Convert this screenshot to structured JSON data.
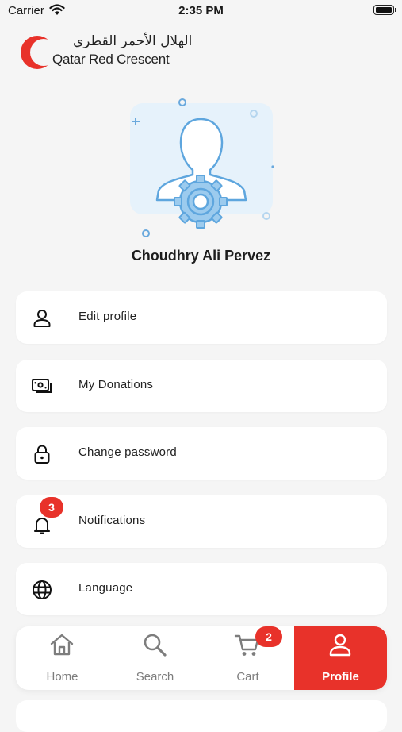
{
  "status_bar": {
    "carrier": "Carrier",
    "time": "2:35 PM"
  },
  "logo": {
    "arabic": "الهلال الأحمر القطري",
    "english": "Qatar Red Crescent"
  },
  "profile": {
    "name": "Choudhry Ali Pervez"
  },
  "menu": [
    {
      "label": "Edit profile",
      "icon": "user-icon"
    },
    {
      "label": "My Donations",
      "icon": "donations-icon"
    },
    {
      "label": "Change password",
      "icon": "lock-icon"
    },
    {
      "label": "Notifications",
      "icon": "bell-icon",
      "badge": "3"
    },
    {
      "label": "Language",
      "icon": "globe-icon"
    }
  ],
  "tabs": [
    {
      "label": "Home",
      "icon": "home-icon"
    },
    {
      "label": "Search",
      "icon": "search-icon"
    },
    {
      "label": "Cart",
      "icon": "cart-icon",
      "badge": "2"
    },
    {
      "label": "Profile",
      "icon": "profile-icon",
      "active": true
    }
  ],
  "colors": {
    "accent": "#e8322a",
    "background": "#f5f5f5",
    "card": "#ffffff",
    "avatar_blue": "#5ea6de"
  }
}
